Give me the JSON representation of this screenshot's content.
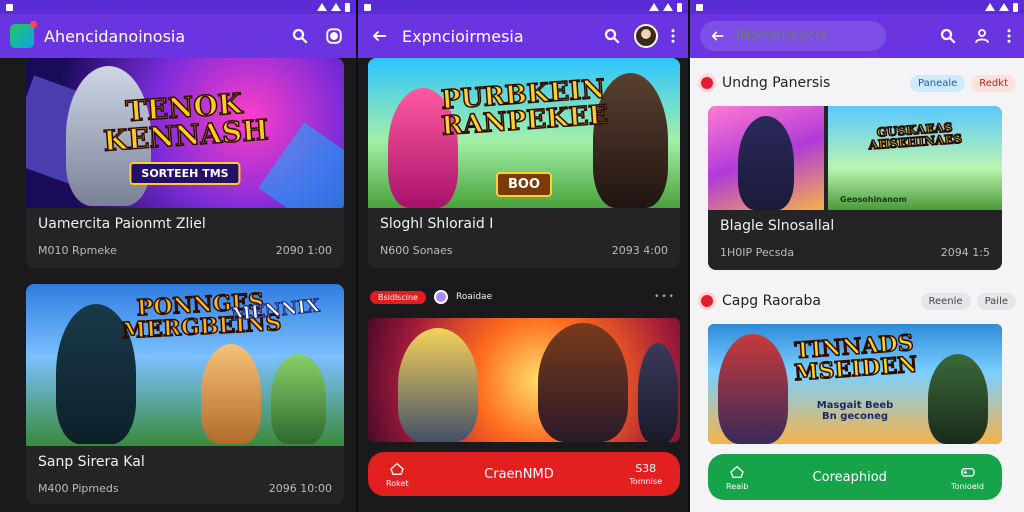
{
  "screen1": {
    "status": {
      "time": ""
    },
    "appbar": {
      "title": "Ahencidanoinosia"
    },
    "cards": [
      {
        "art_title": "TENOK\nKENNASH",
        "art_sub": "SORTEEH TMS",
        "name": "Uamercita Paionmt Zliel",
        "left": "M010 Rpmeke",
        "right": "2090 1:00"
      },
      {
        "art_title": "PONNGES\nMERGBEINS",
        "art_title2": "MENNIX",
        "name": "Sanp Sirera Kal",
        "left": "M400 Pipmeds",
        "right": "2096 10:00"
      }
    ]
  },
  "screen2": {
    "appbar": {
      "title": "Expncioirmesia"
    },
    "cards": [
      {
        "art_title": "PURBKEIN\nRANPEKEE",
        "art_sub": "BOO",
        "name": "Sloghl Shloraid I",
        "left": "N600 Sonaes",
        "right": "2093 4:00"
      }
    ],
    "promo": {
      "badge": "Bsidlscine",
      "label": "Roaidae"
    },
    "cta": {
      "left": "Roket",
      "main": "CraenNMD",
      "right": "Tomnise",
      "right_top": "S38"
    }
  },
  "screen3": {
    "search": {
      "placeholder": "INomeneacie"
    },
    "sections": [
      {
        "title": "Undng Panersis",
        "chip1": "Paneale",
        "chip2": "Redkt",
        "art_title": "GUSKAEAS\nAHSEHINAES",
        "art_sub": "Geosohinanom",
        "name": "Blagle Slnosallal",
        "left": "1H0IP Pecsda",
        "right": "2094 1:5"
      },
      {
        "title": "Capg Raoraba",
        "chip1": "Reenle",
        "chip2": "Paile",
        "art_title": "TINNADS\nMSEIDEN",
        "art_sub": "Masgait Beeb\nBn geconeg"
      }
    ],
    "cta": {
      "left": "Reaib",
      "main": "Coreaphiod",
      "right": "Tonioeld"
    }
  },
  "colors": {
    "appbar": "#6a35e0",
    "status": "#5b2bd6",
    "cta_red": "#e31f1f",
    "cta_green": "#16a34a"
  }
}
